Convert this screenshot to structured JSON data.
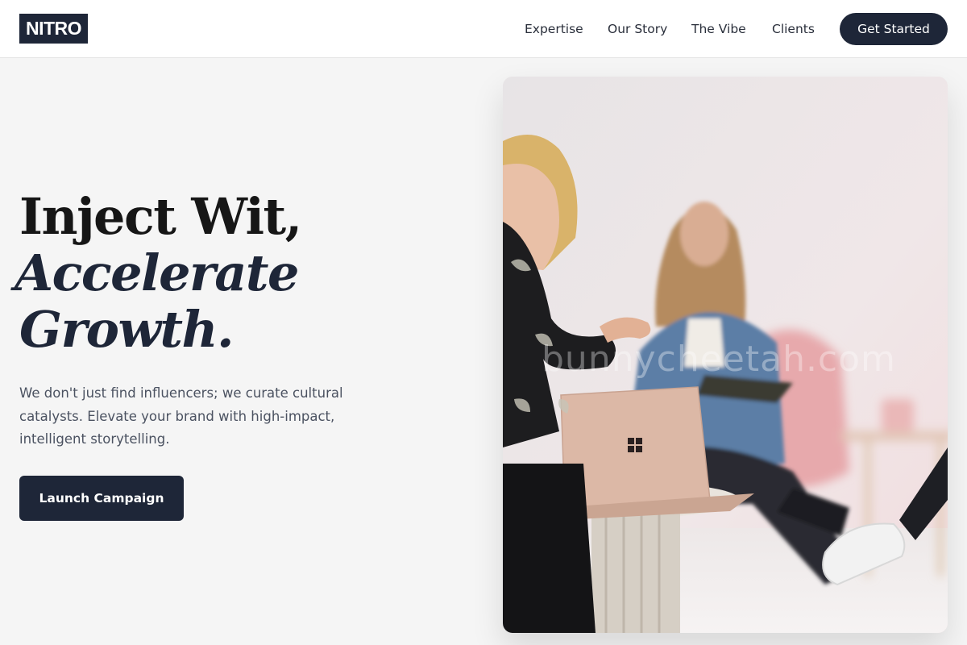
{
  "header": {
    "logo": "NITRO",
    "nav": [
      "Expertise",
      "Our Story",
      "The Vibe",
      "Clients"
    ],
    "cta": "Get Started"
  },
  "hero": {
    "title_line1": "Inject Wit,",
    "title_line2": "Accelerate",
    "title_line3": "Growth.",
    "description": "We don't just find influencers; we curate cultural catalysts. Elevate your brand with high-impact, intelligent storytelling.",
    "cta": "Launch Campaign"
  },
  "photo": {
    "watermark": "bunnycheetah.com"
  },
  "colors": {
    "brand_dark": "#1e2638",
    "background": "#f5f5f5",
    "text_muted": "#4b5261"
  }
}
